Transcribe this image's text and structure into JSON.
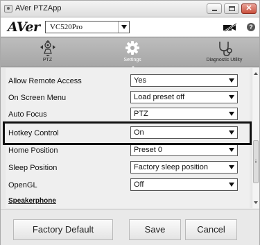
{
  "window": {
    "title": "AVer PTZApp"
  },
  "header": {
    "logo_text": "AVer",
    "device_select_value": "VC520Pro",
    "mute_icon": "camera-mute-icon",
    "help_icon": "help-icon",
    "help_glyph": "?"
  },
  "tabs": [
    {
      "label": "PTZ",
      "icon": "ptz-icon"
    },
    {
      "label": "Settings",
      "icon": "gear-icon",
      "active": true
    },
    {
      "label": "Diagnostic Utility",
      "icon": "stethoscope-icon"
    }
  ],
  "settings": {
    "rows": [
      {
        "label": "Allow Remote Access",
        "value": "Yes"
      },
      {
        "label": "On Screen Menu",
        "value": "Load preset off"
      },
      {
        "label": "Auto Focus",
        "value": "PTZ"
      },
      {
        "label": "Hotkey Control",
        "value": "On",
        "highlighted": true
      },
      {
        "label": "Home Position",
        "value": "Preset 0"
      },
      {
        "label": "Sleep Position",
        "value": "Factory sleep position"
      },
      {
        "label": "OpenGL",
        "value": "Off"
      }
    ],
    "section_link": "Speakerphone"
  },
  "footer": {
    "factory_default_label": "Factory Default",
    "save_label": "Save",
    "cancel_label": "Cancel"
  },
  "colors": {
    "tabbar": "#b3b3b3",
    "panel": "#efefef",
    "highlight_border": "#111111"
  }
}
